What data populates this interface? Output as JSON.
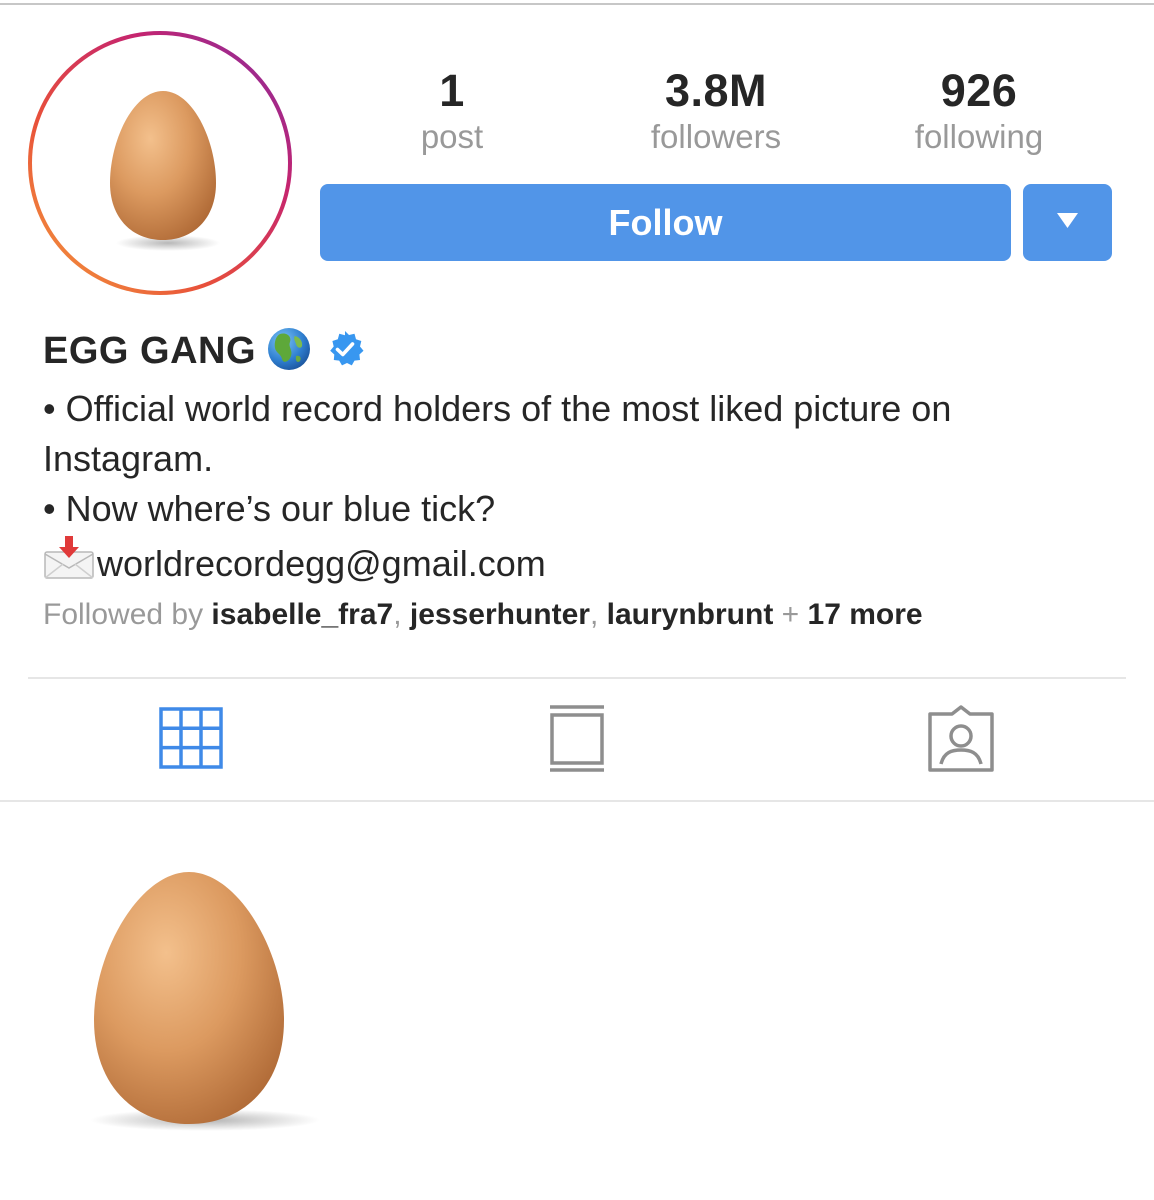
{
  "stats": {
    "posts": {
      "value": "1",
      "label": "post"
    },
    "followers": {
      "value": "3.8M",
      "label": "followers"
    },
    "following": {
      "value": "926",
      "label": "following"
    }
  },
  "actions": {
    "follow_label": "Follow",
    "dropdown_icon": "caret-down-icon"
  },
  "profile": {
    "name": "EGG GANG",
    "name_icons": [
      "globe-icon",
      "verified-badge-icon"
    ],
    "bio_line1": "• Official world record holders of the most liked picture on",
    "bio_line2": "Instagram.",
    "bio_line3": "• Now where’s our blue tick?",
    "email": "worldrecordegg@gmail.com",
    "email_icon": "incoming-envelope-icon"
  },
  "followed_by": {
    "prefix": "Followed by",
    "users": [
      "isabelle_fra7",
      "jesserhunter",
      "laurynbrunt"
    ],
    "more_prefix": "+",
    "more": "17 more"
  },
  "tabs": [
    {
      "icon": "grid-icon",
      "active": true
    },
    {
      "icon": "feed-icon",
      "active": false
    },
    {
      "icon": "tagged-icon",
      "active": false
    }
  ],
  "colors": {
    "accent": "#5195e8",
    "text": "#262626",
    "muted": "#999999",
    "verified": "#3897f0",
    "egg": "#d4935c"
  }
}
